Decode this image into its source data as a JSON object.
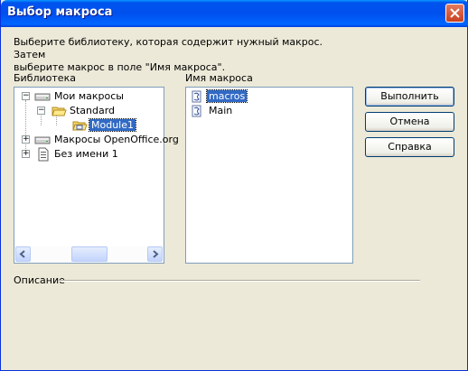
{
  "window": {
    "title": "Выбор макроса"
  },
  "description": {
    "line1": "Выберите библиотеку, которая содержит нужный макрос. Затем",
    "line2": "выберите макрос в поле \"Имя макроса\"."
  },
  "library": {
    "label": "Библиотека",
    "nodes": {
      "my_macros": "Мои макросы",
      "standard": "Standard",
      "module1": "Module1",
      "oo_macros": "Макросы OpenOffice.org",
      "untitled": "Без имени 1"
    }
  },
  "macro_name": {
    "label": "Имя макроса",
    "items": [
      "macros",
      "Main"
    ],
    "selected": "macros"
  },
  "buttons": {
    "run": "Выполнить",
    "cancel": "Отмена",
    "help": "Справка"
  },
  "description_section": {
    "label": "Описание"
  }
}
